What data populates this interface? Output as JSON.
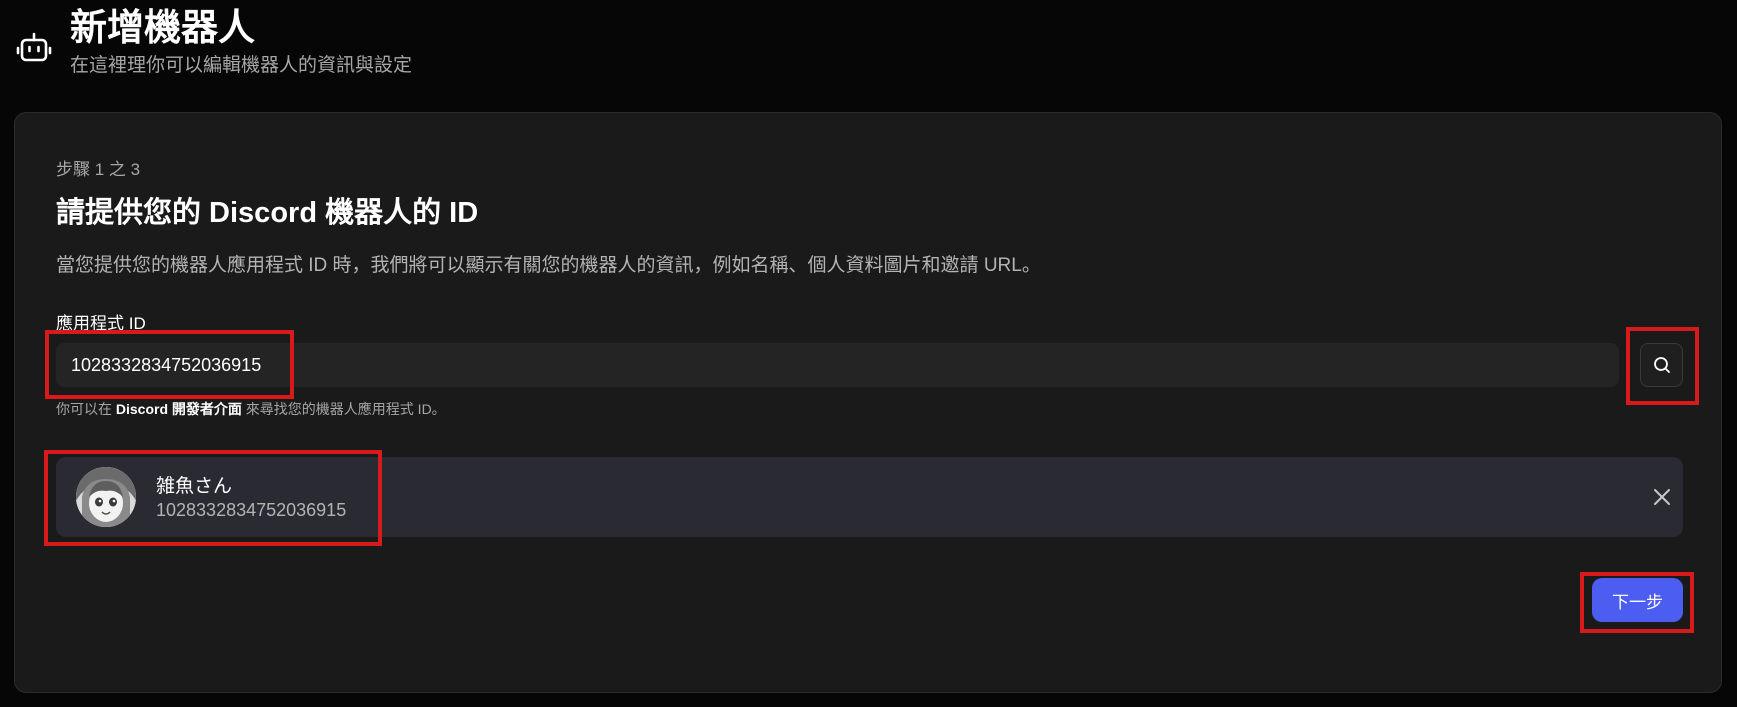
{
  "header": {
    "icon": "robot-icon",
    "title": "新增機器人",
    "subtitle": "在這裡理你可以編輯機器人的資訊與設定"
  },
  "form": {
    "step_label": "步驟 1 之 3",
    "title": "請提供您的 Discord 機器人的 ID",
    "description": "當您提供您的機器人應用程式 ID 時，我們將可以顯示有關您的機器人的資訊，例如名稱、個人資料圖片和邀請 URL。",
    "field_label": "應用程式 ID",
    "app_id_value": "1028332834752036915",
    "search_icon": "search-icon",
    "hint_prefix": "你可以在",
    "hint_link": "Discord 開發者介面",
    "hint_suffix": "來尋找您的機器人應用程式 ID。"
  },
  "bot": {
    "name": "雑魚さん",
    "id": "1028332834752036915",
    "avatar_icon": "avatar",
    "remove_icon": "close-icon"
  },
  "actions": {
    "next_label": "下一步"
  },
  "colors": {
    "background": "#060606",
    "card": "#1a1a1a",
    "bot_card": "#2a2a33",
    "accent": "#4c5ef2",
    "highlight": "#d71a1a"
  }
}
